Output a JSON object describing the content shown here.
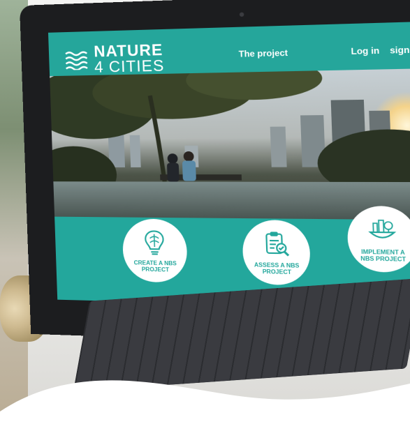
{
  "site": {
    "logo_line1": "NATURE",
    "logo_line2": "4 CITIES",
    "nav": {
      "project": "The project",
      "login": "Log in",
      "signup": "sign up"
    },
    "cards": [
      {
        "label": "CREATE A NBS PROJECT",
        "icon": "brain-lightbulb-icon"
      },
      {
        "label": "ASSESS A NBS PROJECT",
        "icon": "clipboard-magnifier-icon"
      },
      {
        "label": "IMPLEMENT A NBS PROJECT",
        "icon": "city-plants-icon"
      }
    ]
  },
  "colors": {
    "teal": "#23a79c",
    "white": "#ffffff",
    "laptop_bezel": "#1c1d1f"
  }
}
